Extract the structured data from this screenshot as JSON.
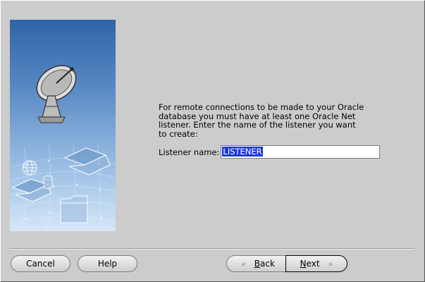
{
  "prompt": {
    "lines": [
      "For remote connections to be made to your Oracle",
      "database you must have at least one Oracle Net",
      "listener. Enter the name of the listener you want",
      "to create:"
    ]
  },
  "listener": {
    "label": "Listener name:",
    "value": "LISTENER"
  },
  "buttons": {
    "cancel": "Cancel",
    "help": "Help",
    "back_first": "B",
    "back_rest": "ack",
    "next_first": "N",
    "next_rest": "ext"
  },
  "icons": {
    "back_arrow": "«",
    "next_arrow": "»",
    "side_image": "satellite-dish-network-illustration"
  },
  "colors": {
    "selection": "#1f3bd6",
    "dialog_bg": "#cccccc"
  }
}
